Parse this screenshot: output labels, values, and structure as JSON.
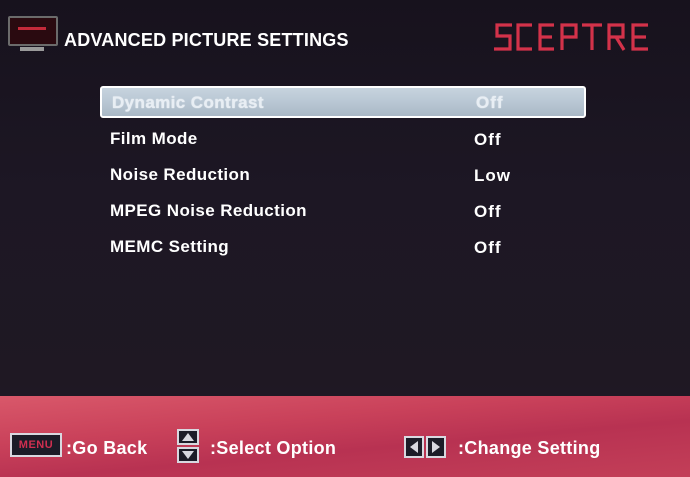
{
  "header": {
    "title": "ADVANCED PICTURE SETTINGS",
    "brand": "SCEPTRE",
    "brand_color": "#d3324a"
  },
  "menu": {
    "items": [
      {
        "label": "Dynamic Contrast",
        "value": "Off",
        "selected": true
      },
      {
        "label": "Film Mode",
        "value": "Off",
        "selected": false
      },
      {
        "label": "Noise Reduction",
        "value": "Low",
        "selected": false
      },
      {
        "label": "MPEG Noise Reduction",
        "value": "Off",
        "selected": false
      },
      {
        "label": "MEMC Setting",
        "value": "Off",
        "selected": false
      }
    ]
  },
  "footer": {
    "menu_key": "MENU",
    "go_back": ":Go Back",
    "select_option": ":Select Option",
    "change_setting": ":Change Setting",
    "updown_icon": "up-down-arrows-icon",
    "leftright_icon": "left-right-arrows-icon"
  }
}
